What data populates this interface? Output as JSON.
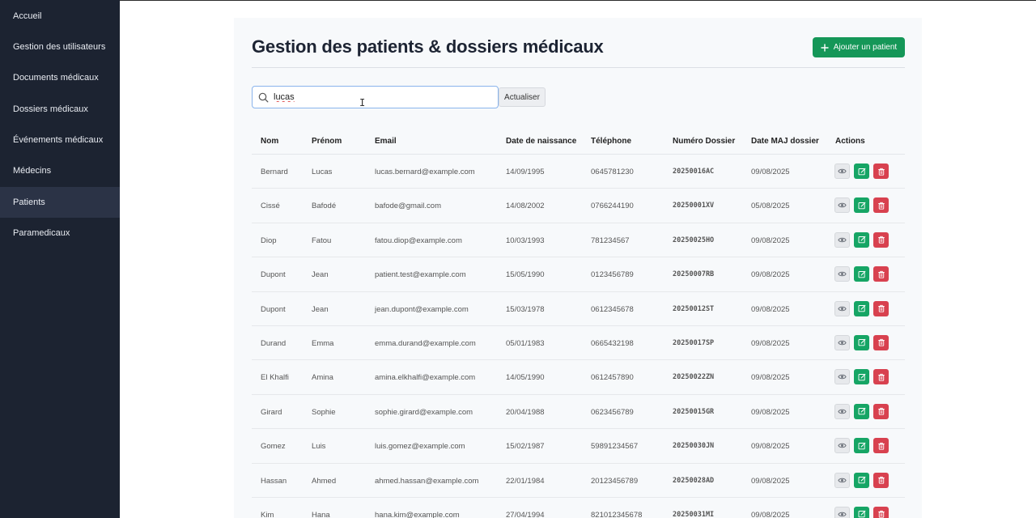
{
  "sidebar": {
    "items": [
      {
        "label": "Accueil"
      },
      {
        "label": "Gestion des utilisateurs"
      },
      {
        "label": "Documents médicaux"
      },
      {
        "label": "Dossiers médicaux"
      },
      {
        "label": "Événements médicaux"
      },
      {
        "label": "Médecins"
      },
      {
        "label": "Patients",
        "active": true
      },
      {
        "label": "Paramedicaux"
      }
    ]
  },
  "header": {
    "title": "Gestion des patients & dossiers médicaux",
    "add_button": "Ajouter un patient"
  },
  "search": {
    "value": "lucas",
    "refresh_label": "Actualiser"
  },
  "table": {
    "columns": [
      "Nom",
      "Prénom",
      "Email",
      "Date de naissance",
      "Téléphone",
      "Numéro Dossier",
      "Date MAJ dossier",
      "Actions"
    ],
    "rows": [
      {
        "nom": "Bernard",
        "prenom": "Lucas",
        "email": "lucas.bernard@example.com",
        "naissance": "14/09/1995",
        "tel": "0645781230",
        "dossier": "20250016AC",
        "maj": "09/08/2025"
      },
      {
        "nom": "Cissé",
        "prenom": "Bafodé",
        "email": "bafode@gmail.com",
        "naissance": "14/08/2002",
        "tel": "0766244190",
        "dossier": "20250001XV",
        "maj": "05/08/2025"
      },
      {
        "nom": "Diop",
        "prenom": "Fatou",
        "email": "fatou.diop@example.com",
        "naissance": "10/03/1993",
        "tel": "781234567",
        "dossier": "20250025HO",
        "maj": "09/08/2025"
      },
      {
        "nom": "Dupont",
        "prenom": "Jean",
        "email": "patient.test@example.com",
        "naissance": "15/05/1990",
        "tel": "0123456789",
        "dossier": "20250007RB",
        "maj": "09/08/2025"
      },
      {
        "nom": "Dupont",
        "prenom": "Jean",
        "email": "jean.dupont@example.com",
        "naissance": "15/03/1978",
        "tel": "0612345678",
        "dossier": "20250012ST",
        "maj": "09/08/2025"
      },
      {
        "nom": "Durand",
        "prenom": "Emma",
        "email": "emma.durand@example.com",
        "naissance": "05/01/1983",
        "tel": "0665432198",
        "dossier": "20250017SP",
        "maj": "09/08/2025"
      },
      {
        "nom": "El Khalfi",
        "prenom": "Amina",
        "email": "amina.elkhalfi@example.com",
        "naissance": "14/05/1990",
        "tel": "0612457890",
        "dossier": "20250022ZN",
        "maj": "09/08/2025"
      },
      {
        "nom": "Girard",
        "prenom": "Sophie",
        "email": "sophie.girard@example.com",
        "naissance": "20/04/1988",
        "tel": "0623456789",
        "dossier": "20250015GR",
        "maj": "09/08/2025"
      },
      {
        "nom": "Gomez",
        "prenom": "Luis",
        "email": "luis.gomez@example.com",
        "naissance": "15/02/1987",
        "tel": "59891234567",
        "dossier": "20250030JN",
        "maj": "09/08/2025"
      },
      {
        "nom": "Hassan",
        "prenom": "Ahmed",
        "email": "ahmed.hassan@example.com",
        "naissance": "22/01/1984",
        "tel": "20123456789",
        "dossier": "20250028AD",
        "maj": "09/08/2025"
      },
      {
        "nom": "Kim",
        "prenom": "Hana",
        "email": "hana.kim@example.com",
        "naissance": "27/04/1994",
        "tel": "821012345678",
        "dossier": "20250031MI",
        "maj": "09/08/2025"
      }
    ]
  },
  "icons": {
    "search": "search-icon",
    "add": "plus-icon",
    "view": "eye-icon",
    "edit": "edit-icon",
    "delete": "trash-icon"
  },
  "colors": {
    "sidebar_bg": "#1c2331",
    "sidebar_active": "#2b3346",
    "add_button": "#159758",
    "edit_button": "#16a565",
    "delete_button": "#d8414f"
  }
}
